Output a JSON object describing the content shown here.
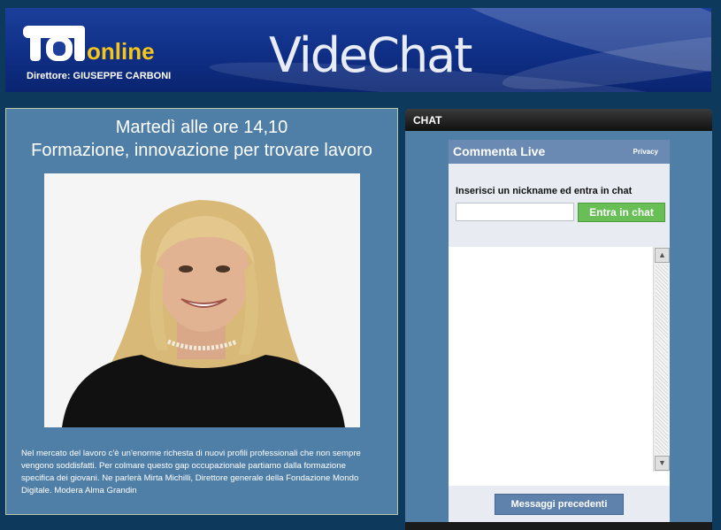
{
  "banner": {
    "logo_text": "tg1",
    "logo_suffix": "online",
    "director": "Direttore: GIUSEPPE CARBONI",
    "title": "VideChat"
  },
  "episode": {
    "time": "Martedì alle ore 14,10",
    "title": "Formazione, innovazione per trovare lavoro",
    "description": "Nel mercato del lavoro c'è un'enorme richesta di nuovi profili professionali che non sempre vengono soddisfatti. Per colmare questo gap occupazionale partiamo dalla formazione specifica dei giovani. Ne parlerà Mirta Michilli, Direttore generale della Fondazione Mondo Digitale. Modera Alma Grandin"
  },
  "chat": {
    "header": "CHAT",
    "widget_title": "Commenta Live",
    "privacy": "Privacy",
    "nickname_prompt": "Inserisci un nickname ed entra in chat",
    "nickname_value": "",
    "enter_button": "Entra in chat",
    "previous_button": "Messaggi precedenti"
  },
  "colors": {
    "page_bg": "#0d3a5c",
    "panel_bg": "#4f7fa6",
    "accent_green": "#67bf55",
    "logo_yellow": "#f5c518"
  },
  "icons": [
    "scroll-up-arrow-icon",
    "scroll-down-arrow-icon"
  ]
}
